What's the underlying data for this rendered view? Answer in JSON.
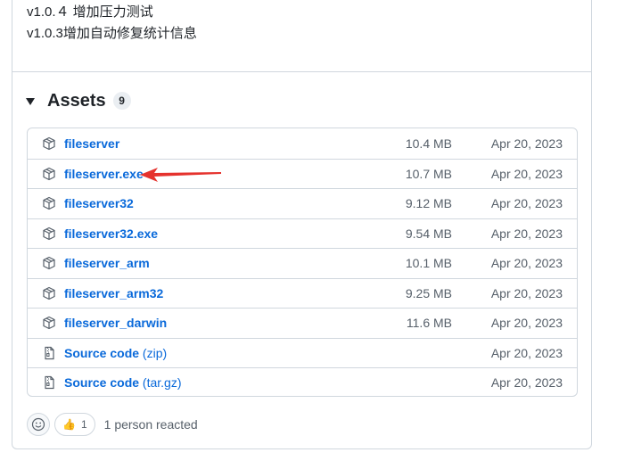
{
  "release_notes": [
    "v1.0.４ 增加压力测试",
    "v1.0.3增加自动修复统计信息"
  ],
  "assets": {
    "title": "Assets",
    "count": "9",
    "items": [
      {
        "name": "fileserver",
        "ext": "",
        "size": "10.4 MB",
        "date": "Apr 20, 2023",
        "icon": "package-icon"
      },
      {
        "name": "fileserver.exe",
        "ext": "",
        "size": "10.7 MB",
        "date": "Apr 20, 2023",
        "icon": "package-icon"
      },
      {
        "name": "fileserver32",
        "ext": "",
        "size": "9.12 MB",
        "date": "Apr 20, 2023",
        "icon": "package-icon"
      },
      {
        "name": "fileserver32.exe",
        "ext": "",
        "size": "9.54 MB",
        "date": "Apr 20, 2023",
        "icon": "package-icon"
      },
      {
        "name": "fileserver_arm",
        "ext": "",
        "size": "10.1 MB",
        "date": "Apr 20, 2023",
        "icon": "package-icon"
      },
      {
        "name": "fileserver_arm32",
        "ext": "",
        "size": "9.25 MB",
        "date": "Apr 20, 2023",
        "icon": "package-icon"
      },
      {
        "name": "fileserver_darwin",
        "ext": "",
        "size": "11.6 MB",
        "date": "Apr 20, 2023",
        "icon": "package-icon"
      },
      {
        "name": "Source code",
        "ext": "(zip)",
        "size": "",
        "date": "Apr 20, 2023",
        "icon": "file-zip-icon"
      },
      {
        "name": "Source code",
        "ext": "(tar.gz)",
        "size": "",
        "date": "Apr 20, 2023",
        "icon": "file-zip-icon"
      }
    ]
  },
  "reactions": {
    "emoji": "👍",
    "count": "1",
    "text": "1 person reacted"
  },
  "colors": {
    "link": "#0969da",
    "muted": "#57606a",
    "border": "#d0d7de",
    "annotation_arrow": "#e5322d"
  }
}
